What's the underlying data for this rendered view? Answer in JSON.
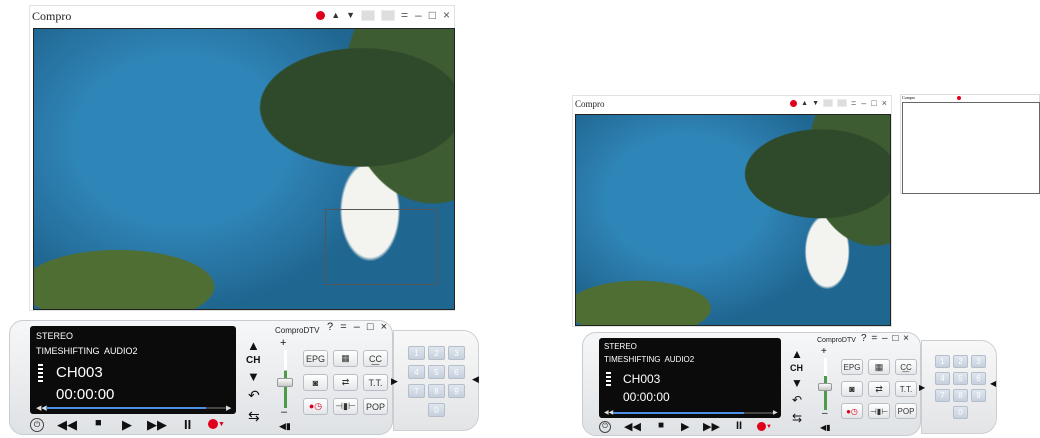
{
  "left": {
    "window": {
      "title": "Compro",
      "buttons": {
        "arrow_up": "▲",
        "arrow_down": "▼",
        "menu": "=",
        "minimize": "–",
        "maximize": "□",
        "close": "×"
      }
    },
    "panel": {
      "app_title": "ComproDTV",
      "help": "?",
      "menu": "=",
      "minimize": "–",
      "maximize": "□",
      "close": "×",
      "lcd": {
        "audio_mode": "STEREO",
        "status": "TIMESHIFTING  AUDIO2",
        "channel": "CH003",
        "time": "00:00:00",
        "progress": 0.82
      },
      "ch_label": "CH",
      "buttons": {
        "epg": "EPG",
        "tt": "T.T.",
        "pop": "POP"
      },
      "volume_level": 0.6,
      "numpad": [
        "1",
        "2",
        "3",
        "4",
        "5",
        "6",
        "7",
        "8",
        "9",
        "0"
      ]
    }
  },
  "right": {
    "window": {
      "title": "Compro",
      "buttons": {
        "arrow_up": "▲",
        "arrow_down": "▼",
        "menu": "=",
        "minimize": "–",
        "maximize": "□",
        "close": "×"
      }
    },
    "pop_window": {
      "title": "Compro"
    },
    "panel": {
      "app_title": "ComproDTV",
      "help": "?",
      "menu": "=",
      "minimize": "–",
      "maximize": "□",
      "close": "×",
      "lcd": {
        "audio_mode": "STEREO",
        "status": "TIMESHIFTING  AUDIO2",
        "channel": "CH003",
        "time": "00:00:00",
        "progress": 0.82
      },
      "ch_label": "CH",
      "buttons": {
        "epg": "EPG",
        "tt": "T.T.",
        "pop": "POP"
      },
      "volume_level": 0.6,
      "numpad": [
        "1",
        "2",
        "3",
        "4",
        "5",
        "6",
        "7",
        "8",
        "9",
        "0"
      ]
    }
  }
}
